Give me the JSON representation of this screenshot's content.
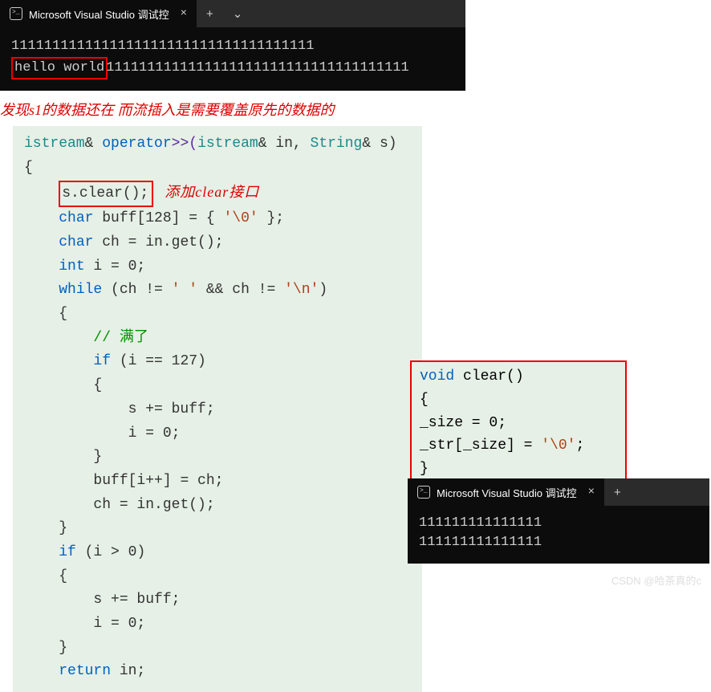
{
  "console1": {
    "tab_title": "Microsoft Visual Studio 调试控",
    "line1": "1111111111111111111111111111111111111",
    "hello": "hello world",
    "line2_rest": "1111111111111111111111111111111111111"
  },
  "annotation": "发现s1的数据还在 而流插入是需要覆盖原先的数据的",
  "code1": {
    "sig_istream": "istream",
    "sig_amp": "& ",
    "sig_op": "operator",
    "sig_gtgt": ">>(",
    "sig_in": "in",
    "sig_comma": ", ",
    "sig_String": "String",
    "sig_s": "s",
    "clear_call": "s.clear();",
    "clear_label": "添加clear接口",
    "char1": "char",
    "buff_decl": " buff[128] = { ",
    "nul": "'\\0'",
    "buff_end": " };",
    "char2": "char",
    "ch_decl": " ch = in.get();",
    "int_kw": "int",
    "i_decl": " i = 0;",
    "while_kw": "while",
    "while_cond_a": " (ch != ",
    "space_ch": "' '",
    "while_and": " && ch != ",
    "nl_ch": "'\\n'",
    "while_end": ")",
    "comment_full": "// 满了",
    "if_kw": "if",
    "if_127": " (i == 127)",
    "s_buff": "s += buff;",
    "i_zero": "i = 0;",
    "buff_assign": "buff[i++] = ch;",
    "ch_get": "ch = in.get();",
    "if_i": " (i > 0)",
    "return_kw": "return",
    "return_in": " in;"
  },
  "code2": {
    "void_kw": "void",
    "clear_sig": " clear()",
    "size_zero": "_size = 0;",
    "str_assign_a": "_str[_size] = ",
    "nul2": "'\\0'",
    "str_assign_b": ";"
  },
  "console2": {
    "tab_title": "Microsoft Visual Studio 调试控",
    "line1": "111111111111111",
    "line2": "111111111111111"
  },
  "watermark": "CSDN @哈茶真的c"
}
